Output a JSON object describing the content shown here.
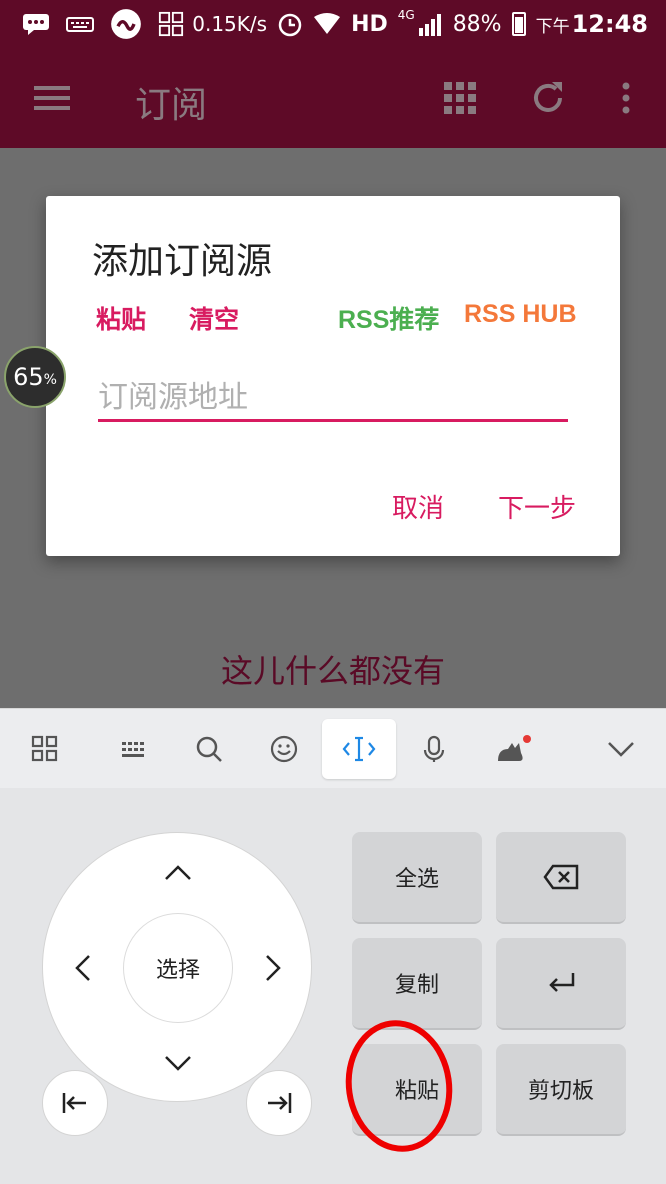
{
  "status_bar": {
    "speed": "0.15K/s",
    "network": "HD",
    "signal_type": "4G",
    "battery": "88%",
    "time_prefix": "下午",
    "time": "12:48",
    "icons": [
      "message-icon",
      "keyboard-icon",
      "app-icon",
      "grid-icon",
      "alarm-icon",
      "wifi-icon",
      "signal-icon",
      "battery-icon"
    ]
  },
  "app_bar": {
    "title": "订阅",
    "icons": [
      "menu-icon",
      "apps-icon",
      "refresh-icon",
      "more-icon"
    ]
  },
  "dialog": {
    "title": "添加订阅源",
    "paste": "粘贴",
    "clear": "清空",
    "rss_recommend": "RSS推荐",
    "rss_hub": "RSS HUB",
    "input_placeholder": "订阅源地址",
    "input_value": "",
    "cancel": "取消",
    "next": "下一步",
    "colors": {
      "accent": "#d81b60",
      "green": "#4caf50",
      "orange": "#f4783a"
    }
  },
  "badge": {
    "value": "65",
    "unit": "%"
  },
  "empty_text": "这儿什么都没有",
  "keyboard": {
    "toolbar": [
      "grid-icon",
      "keyboard-icon",
      "search-icon",
      "emoji-icon",
      "cursor-icon",
      "mic-icon",
      "cat-icon",
      "collapse-icon"
    ],
    "dpad_center": "选择",
    "keys": {
      "select_all": "全选",
      "copy": "复制",
      "paste": "粘贴",
      "clipboard": "剪切板"
    }
  }
}
